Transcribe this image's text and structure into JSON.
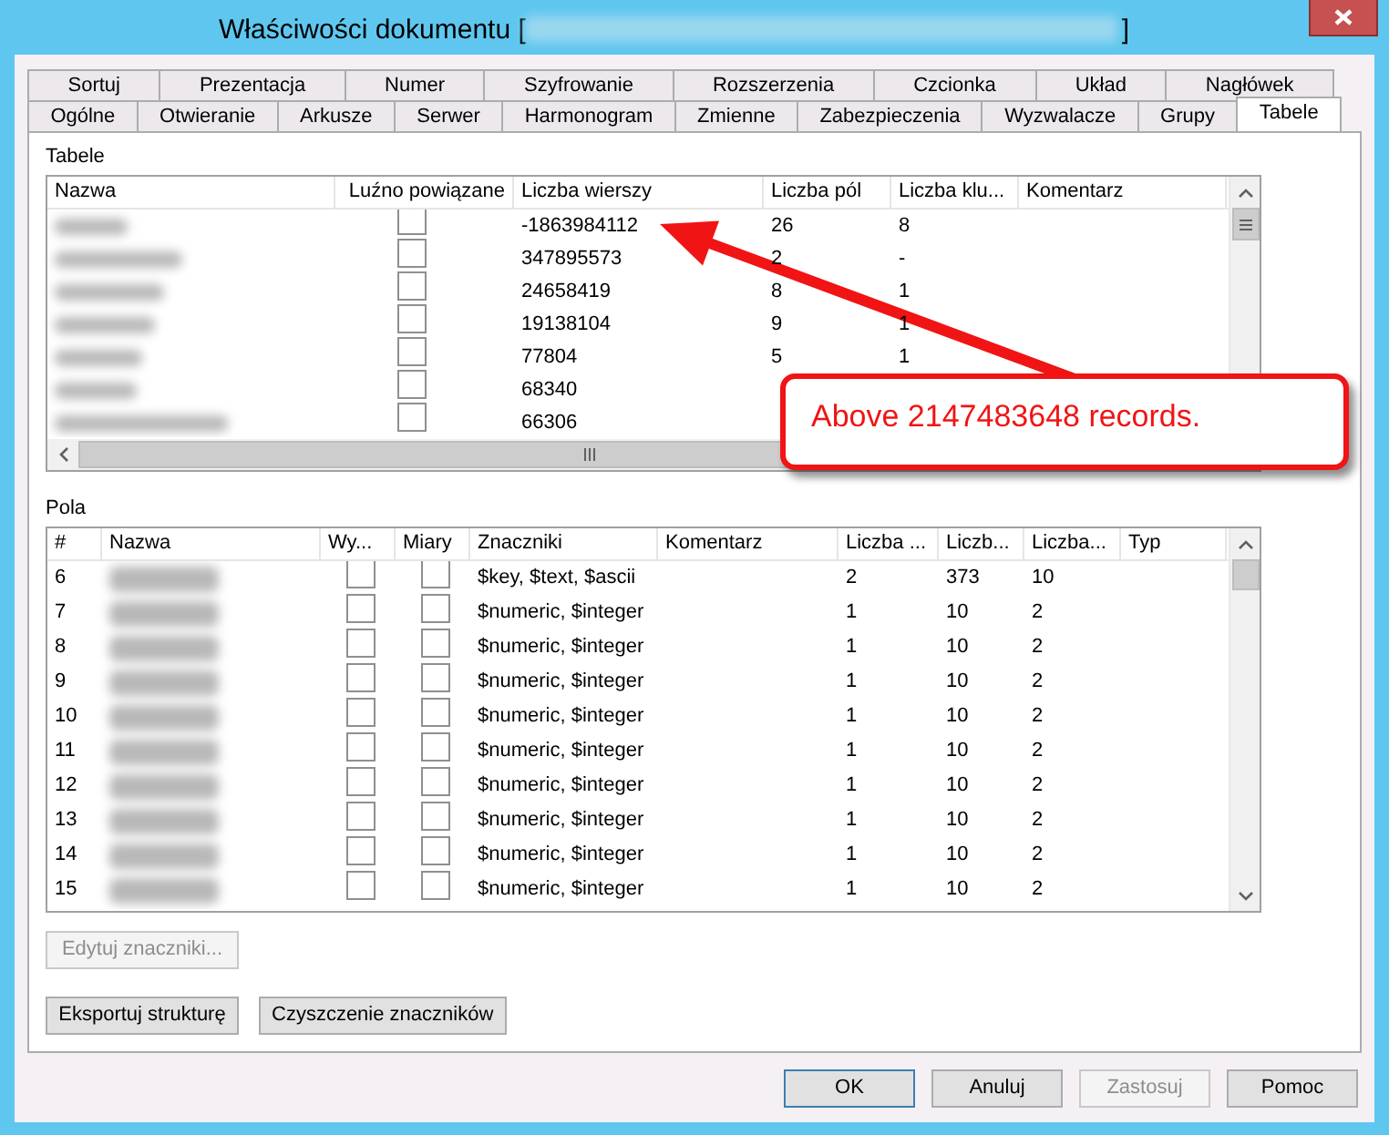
{
  "window": {
    "title_prefix": "Właściwości dokumentu [",
    "title_suffix": "]"
  },
  "tab_rows": [
    {
      "tabs": [
        {
          "label": "Sortuj",
          "selected": false
        },
        {
          "label": "Prezentacja",
          "selected": false
        },
        {
          "label": "Numer",
          "selected": false
        },
        {
          "label": "Szyfrowanie",
          "selected": false
        },
        {
          "label": "Rozszerzenia",
          "selected": false
        },
        {
          "label": "Czcionka",
          "selected": false
        },
        {
          "label": "Układ",
          "selected": false
        },
        {
          "label": "Nagłówek",
          "selected": false
        }
      ]
    },
    {
      "tabs": [
        {
          "label": "Ogólne",
          "selected": false
        },
        {
          "label": "Otwieranie",
          "selected": false
        },
        {
          "label": "Arkusze",
          "selected": false
        },
        {
          "label": "Serwer",
          "selected": false
        },
        {
          "label": "Harmonogram",
          "selected": false
        },
        {
          "label": "Zmienne",
          "selected": false
        },
        {
          "label": "Zabezpieczenia",
          "selected": false
        },
        {
          "label": "Wyzwalacze",
          "selected": false
        },
        {
          "label": "Grupy",
          "selected": false
        },
        {
          "label": "Tabele",
          "selected": true
        }
      ]
    }
  ],
  "tables": {
    "label": "Tabele",
    "columns": [
      "Nazwa",
      "Luźno powiązane",
      "Liczba wierszy",
      "Liczba pól",
      "Liczba klu...",
      "Komentarz"
    ],
    "rows": [
      {
        "loosely_linked": false,
        "row_count": "-1863984112",
        "field_count": "26",
        "key_count": "8"
      },
      {
        "loosely_linked": false,
        "row_count": "347895573",
        "field_count": "2",
        "key_count": "-"
      },
      {
        "loosely_linked": false,
        "row_count": "24658419",
        "field_count": "8",
        "key_count": "1"
      },
      {
        "loosely_linked": false,
        "row_count": "19138104",
        "field_count": "9",
        "key_count": "1"
      },
      {
        "loosely_linked": false,
        "row_count": "77804",
        "field_count": "5",
        "key_count": "1"
      },
      {
        "loosely_linked": false,
        "row_count": "68340"
      },
      {
        "loosely_linked": false,
        "row_count": "66306"
      }
    ]
  },
  "fields": {
    "label": "Pola",
    "columns": [
      "#",
      "Nazwa",
      "Wy...",
      "Miary",
      "Znaczniki",
      "Komentarz",
      "Liczba ...",
      "Liczb...",
      "Liczba...",
      "Typ"
    ],
    "rows": [
      {
        "num": "6",
        "wy": false,
        "measures": false,
        "tags": "$key, $text, $ascii",
        "col_7": "2",
        "col_8": "373",
        "col_9": "10"
      },
      {
        "num": "7",
        "wy": false,
        "measures": false,
        "tags": "$numeric, $integer",
        "col_7": "1",
        "col_8": "10",
        "col_9": "2"
      },
      {
        "num": "8",
        "wy": false,
        "measures": false,
        "tags": "$numeric, $integer",
        "col_7": "1",
        "col_8": "10",
        "col_9": "2"
      },
      {
        "num": "9",
        "wy": false,
        "measures": false,
        "tags": "$numeric, $integer",
        "col_7": "1",
        "col_8": "10",
        "col_9": "2"
      },
      {
        "num": "10",
        "wy": false,
        "measures": false,
        "tags": "$numeric, $integer",
        "col_7": "1",
        "col_8": "10",
        "col_9": "2"
      },
      {
        "num": "11",
        "wy": false,
        "measures": false,
        "tags": "$numeric, $integer",
        "col_7": "1",
        "col_8": "10",
        "col_9": "2"
      },
      {
        "num": "12",
        "wy": false,
        "measures": false,
        "tags": "$numeric, $integer",
        "col_7": "1",
        "col_8": "10",
        "col_9": "2"
      },
      {
        "num": "13",
        "wy": false,
        "measures": false,
        "tags": "$numeric, $integer",
        "col_7": "1",
        "col_8": "10",
        "col_9": "2"
      },
      {
        "num": "14",
        "wy": false,
        "measures": false,
        "tags": "$numeric, $integer",
        "col_7": "1",
        "col_8": "10",
        "col_9": "2"
      },
      {
        "num": "15",
        "wy": false,
        "measures": false,
        "tags": "$numeric, $integer",
        "col_7": "1",
        "col_8": "10",
        "col_9": "2"
      }
    ]
  },
  "edit_tags_button": {
    "label": "Edytuj znaczniki...",
    "disabled": true
  },
  "panel_buttons": [
    {
      "label": "Eksportuj strukturę",
      "disabled": false
    },
    {
      "label": "Czyszczenie znaczników",
      "disabled": false
    }
  ],
  "dialog_buttons": [
    {
      "label": "OK",
      "disabled": false,
      "default": true
    },
    {
      "label": "Anuluj",
      "disabled": false,
      "default": false
    },
    {
      "label": "Zastosuj",
      "disabled": true,
      "default": false
    },
    {
      "label": "Pomoc",
      "disabled": false,
      "default": false
    }
  ],
  "callout": {
    "text": "Above 2147483648 records."
  }
}
